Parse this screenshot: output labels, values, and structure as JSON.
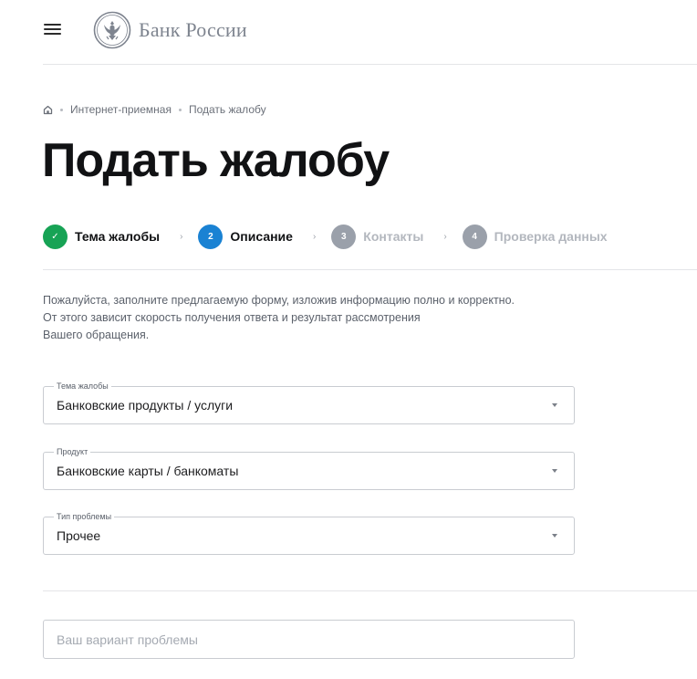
{
  "header": {
    "logo_text": "Банк России"
  },
  "breadcrumb": {
    "items": [
      "Интернет-приемная",
      "Подать жалобу"
    ]
  },
  "page": {
    "title": "Подать жалобу"
  },
  "steps": [
    {
      "number": "✓",
      "label": "Тема жалобы",
      "state": "done"
    },
    {
      "number": "2",
      "label": "Описание",
      "state": "active"
    },
    {
      "number": "3",
      "label": "Контакты",
      "state": "pending"
    },
    {
      "number": "4",
      "label": "Проверка данных",
      "state": "pending"
    }
  ],
  "step_separator": "›",
  "intro": {
    "line1": "Пожалуйста, заполните предлагаемую форму, изложив информацию полно и корректно.",
    "line2": "От этого зависит скорость получения ответа и результат рассмотрения",
    "line3": "Вашего обращения."
  },
  "form": {
    "topic": {
      "label": "Тема жалобы",
      "value": "Банковские продукты / услуги"
    },
    "product": {
      "label": "Продукт",
      "value": "Банковские карты / банкоматы"
    },
    "problem_type": {
      "label": "Тип проблемы",
      "value": "Прочее"
    },
    "custom_problem": {
      "placeholder": "Ваш вариант проблемы",
      "value": ""
    }
  },
  "colors": {
    "step_done": "#17a355",
    "step_active": "#1a82d3",
    "step_pending": "#9aa0aa"
  }
}
